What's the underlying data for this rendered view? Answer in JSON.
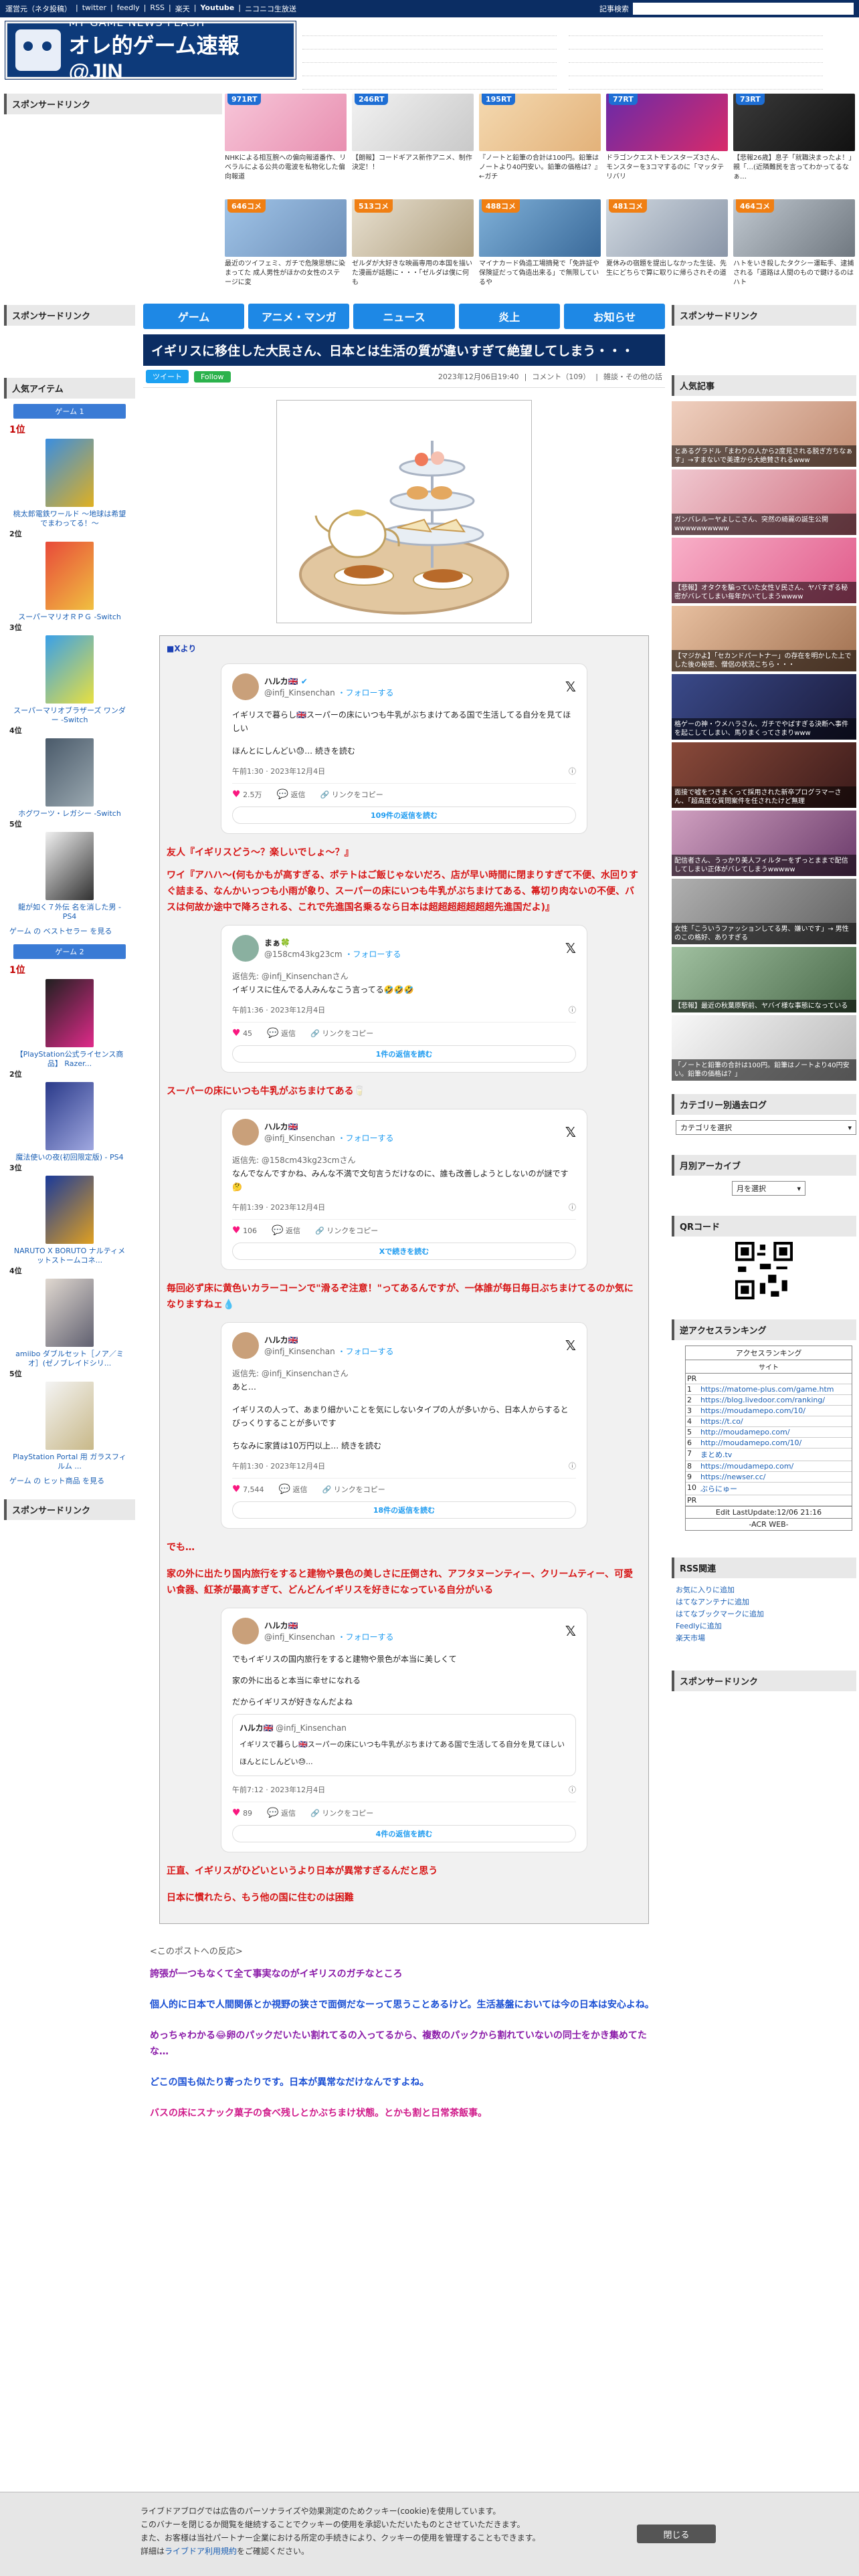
{
  "topbar": {
    "links": [
      "運営元（ネタ投稿）",
      "twitter",
      "feedly",
      "RSS",
      "楽天",
      "Youtube",
      "ニコニコ生放送"
    ],
    "search_label": "記事検索"
  },
  "logo": {
    "sub": "MY GAME NEWS FLASH",
    "main": "オレ的ゲーム速報@JIN"
  },
  "left": {
    "sponsor_title": "スポンサードリンク",
    "sponsor_title2": "スポンサードリンク",
    "popular_title": "人気アイテム",
    "game1_head": "ゲーム 1",
    "game1_ranks": [
      {
        "rank": "1位",
        "name": "桃太郎電鉄ワールド ～地球は希望でまわってる！～"
      },
      {
        "rank": "2位",
        "name": "スーパーマリオＲＰＧ -Switch"
      },
      {
        "rank": "3位",
        "name": "スーパーマリオブラザーズ ワンダー -Switch"
      },
      {
        "rank": "4位",
        "name": "ホグワーツ・レガシー -Switch"
      },
      {
        "rank": "5位",
        "name": "龍が如く７外伝 名を消した男 - PS4"
      }
    ],
    "game1_more": "ゲーム の ベストセラー を見る",
    "game2_head": "ゲーム 2",
    "game2_ranks": [
      {
        "rank": "1位",
        "name": "【PlayStation公式ライセンス商品】 Razer..."
      },
      {
        "rank": "2位",
        "name": "魔法使いの夜(初回限定版) - PS4"
      },
      {
        "rank": "3位",
        "name": "NARUTO X BORUTO ナルティメットストームコネ..."
      },
      {
        "rank": "4位",
        "name": "amiibo ダブルセット［ノア／ミオ］(ゼノブレイドシリ..."
      },
      {
        "rank": "5位",
        "name": "PlayStation Portal 用 ガラスフィルム ..."
      }
    ],
    "game2_more": "ゲーム の ヒット商品 を見る",
    "sponsor_title3": "スポンサードリンク"
  },
  "featured": [
    {
      "badge": "971RT",
      "caption": "NHKによる相互腕への偏向報道番作、リベラルによる公共の電波を私物化した偏向報道"
    },
    {
      "badge": "246RT",
      "caption": "【朗報】コードギアス新作アニメ、制作決定！！"
    },
    {
      "badge": "195RT",
      "caption": "『ノートと鉛筆の合計は100円。鉛筆はノートより40円安い。鉛筆の価格は？』←ガチ"
    },
    {
      "badge": "77RT",
      "caption": "ドラゴンクエストモンスターズ3さん、モンスターを3コマするのに「マッタテリバリ"
    },
    {
      "badge": "73RT",
      "caption": "【悲報26歳】息子「就職決まったよ！」親「…(近隣難民を言ってわかってるなぁ…"
    },
    {
      "badge": "646コメ",
      "caption": "最近のツイフェミ、ガチで危険思想に染まってた 成人男性がほかの女性のステージに変"
    },
    {
      "badge": "513コメ",
      "caption": "ゼルダが大好きな映画専用の本国を描いた漫画が話題に・・・「ゼルダは僕に何も"
    },
    {
      "badge": "488コメ",
      "caption": "マイナカード偽造工場摘発で「免許証や保険証だって偽造出来る」で無限しているや"
    },
    {
      "badge": "481コメ",
      "caption": "夏休みの宿題を提出しなかった生徒、先生にどちらで算に取りに帰らされその道"
    },
    {
      "badge": "464コメ",
      "caption": "ハトをいき殺したタクシー運転手、逮捕される「道路は人間のもので鍵けるのはハト"
    }
  ],
  "nav": [
    "ゲーム",
    "アニメ・マンガ",
    "ニュース",
    "炎上",
    "お知らせ"
  ],
  "article": {
    "title": "イギリスに移住した大民さん、日本とは生活の質が違いすぎて絶望してしまう・・・",
    "tweet_btn": "ツイート",
    "follow_btn": "Follow",
    "date": "2023年12月06日19:40",
    "comments": "コメント（109）",
    "category": "雑談・その他の話",
    "quote_src": "■Xより",
    "tweets": [
      {
        "name": "ハルカ🇬🇧",
        "handle": "@infj_Kinsenchan",
        "follow": "・フォローする",
        "reply_to": "",
        "lines": [
          "イギリスで暮らし🇬🇧スーパーの床にいつも牛乳がぶちまけてある国で生活してる自分を見てほしい",
          "ほんとにしんどい😓… 続きを読む"
        ],
        "time": "午前1:30 · 2023年12月4日",
        "likes": "2.5万",
        "replies": "返信",
        "share": "リンクをコピー",
        "more": "109件の返信を読む"
      },
      {
        "name": "まぁ🍀",
        "handle": "@158cm43kg23cm",
        "follow": "・フォローする",
        "reply_to": "返信先: @infj_Kinsenchanさん",
        "lines": [
          "イギリスに住んでる人みんなこう言ってる🤣🤣🤣"
        ],
        "time": "午前1:36 · 2023年12月4日",
        "likes": "45",
        "replies": "返信",
        "share": "リンクをコピー",
        "more": "1件の返信を読む"
      },
      {
        "name": "ハルカ🇬🇧",
        "handle": "@infj_Kinsenchan",
        "follow": "・フォローする",
        "reply_to": "返信先: @158cm43kg23cmさん",
        "lines": [
          "なんでなんですかね、みんな不満で文句言うだけなのに、誰も改善しようとしないのが謎です🤔"
        ],
        "time": "午前1:39 · 2023年12月4日",
        "likes": "106",
        "replies": "返信",
        "share": "リンクをコピー",
        "more": "Xで続きを読む"
      },
      {
        "name": "ハルカ🇬🇧",
        "handle": "@infj_Kinsenchan",
        "follow": "・フォローする",
        "reply_to": "返信先: @infj_Kinsenchanさん",
        "lines": [
          "あと…",
          "イギリスの人って、あまり細かいことを気にしないタイプの人が多いから、日本人からするとびっくりすることが多いです",
          "ちなみに家賃は10万円以上… 続きを読む"
        ],
        "time": "午前1:30 · 2023年12月4日",
        "likes": "7,544",
        "replies": "返信",
        "share": "リンクをコピー",
        "more": "18件の返信を読む"
      },
      {
        "name": "ハルカ🇬🇧",
        "handle": "@infj_Kinsenchan",
        "follow": "・フォローする",
        "reply_to": "",
        "lines": [
          "でもイギリスの国内旅行をすると建物や景色が本当に美しくて",
          "家の外に出ると本当に幸せになれる",
          "だからイギリスが好きなんだよね"
        ],
        "time": "午前7:12 · 2023年12月4日",
        "likes": "89",
        "replies": "返信",
        "share": "リンクをコピー",
        "more": "4件の返信を読む",
        "inner": {
          "name": "ハルカ🇬🇧",
          "handle": "@infj_Kinsenchan",
          "text": "イギリスで暮らし🇬🇧スーパーの床にいつも牛乳がぶちまけてある国で生活してる自分を見てほしい",
          "sub": "ほんとにしんどい😓..."
        }
      }
    ],
    "red_texts": [
      "友人『イギリスどう〜？楽しいでしょ〜？』",
      "ワイ『アハハ〜(何もかもが高すぎる、ポテトはご飯じゃないだろ、店が早い時間に閉まりすぎて不便、水回りすぐ詰まる、なんかいっつも小雨が象り、スーパーの床にいつも牛乳がぶちまけてある、箒切り肉ないの不便、バスは何故か途中で降ろされる、これで先進国名乗るなら日本は超超超超超超超先進国だよ)』",
      "スーパーの床にいつも牛乳がぶちまけてある🥛",
      "毎回必ず床に黄色いカラーコーンで\"滑るぞ注意！\"ってあるんですが、一体誰が毎日毎日ぶちまけてるのか気になりますねェ💧",
      "でも…",
      "家の外に出たり国内旅行をすると建物や景色の美しさに圧倒され、アフタヌーンティー、クリームティー、可愛い食器、紅茶が最高すぎて、どんどんイギリスを好きになっている自分がいる",
      "正直、イギリスがひどいというより日本が異常すぎるんだと思う",
      "日本に慣れたら、もう他の国に住むのは困難"
    ],
    "replies_head": "<このポストへの反応>",
    "replies": [
      "誇張が一つもなくて全て事実なのがイギリスのガチなところ",
      "個人的に日本で人間関係とか視野の狭さで面倒だなーって思うことあるけど。生活基盤においては今の日本は安心よね。",
      "めっちゃわかる😂卵のパックだいたい割れてるの入ってるから、複数のパックから割れていないの同士をかき集めてたな…",
      "どこの国も似たり寄ったりです。日本が異常なだけなんですよね。",
      "バスの床にスナック菓子の食べ残しとかぶちまけ状態。とかも割と日常茶飯事。"
    ]
  },
  "right": {
    "sponsor_title": "スポンサードリンク",
    "popular_title": "人気記事",
    "popular": [
      "とあるグラドル「まわりの人から2度見される脱ぎ方ちなぁす」→すまないで美達から大絶賛されるwww",
      "ガンバレルーヤよしこさん、突然の綺麗の誕生公開wwwwwwwwww",
      "【悲報】オタクを騙っていた女性Ｖ民さん、ヤバすぎる秘密がバレてしまい毎年かいてしまうwwww",
      "【マジかよ】「セカンドパートナー」の存在を明かした上でした後の秘密、僧侶の状況こちら・・・",
      "格ゲーの神・ウメハラさん、ガチでやばすぎる決断へ事件を起こしてしまい、馬りまくってさまりwww",
      "面接で嘘をつきまくって採用された新卒プログラマーさん、「超高度な質問案件を任されたけど無理",
      "配信者さん、うっかり美人フィルターをずっとままで配信してしまい正体がバレてしまうwwwww",
      "女性「こういうファッションしてる男、嫌いです」→ 男性のこの格好、ありすぎる",
      "【悲報】最近の秋葉原駅前、ヤバイ様な事態になっている",
      "「ノートと鉛筆の合計は100円。鉛筆はノートより40円安い。鉛筆の価格は？」"
    ],
    "category_title": "カテゴリー別過去ログ",
    "category_select": "カテゴリを選択",
    "monthly_title": "月別アーカイブ",
    "monthly_select": "月を選択",
    "qr_title": "QRコード",
    "access_title": "逆アクセスランキング",
    "access_head": "アクセスランキング",
    "access_sub": "サイト",
    "access_rows": [
      {
        "n": "PR",
        "site": ""
      },
      {
        "n": "1",
        "site": "https://matome-plus.com/game.htm"
      },
      {
        "n": "2",
        "site": "https://blog.livedoor.com/ranking/"
      },
      {
        "n": "3",
        "site": "https://moudamepo.com/10/"
      },
      {
        "n": "4",
        "site": "https://t.co/"
      },
      {
        "n": "5",
        "site": "http://moudamepo.com/"
      },
      {
        "n": "6",
        "site": "http://moudamepo.com/10/"
      },
      {
        "n": "7",
        "site": "まとめ.tv"
      },
      {
        "n": "8",
        "site": "https://moudamepo.com/"
      },
      {
        "n": "9",
        "site": "https://newser.cc/"
      },
      {
        "n": "10",
        "site": "ぶらにゅー"
      },
      {
        "n": "PR",
        "site": ""
      }
    ],
    "access_footer": "Edit LastUpdate:12/06 21:16",
    "access_footer2": "-ACR WEB-",
    "rss_title": "RSS関連",
    "rss_links": [
      "お気に入りに追加",
      "はてなアンテナに追加",
      "はてなブックマークに追加",
      "Feedlyに追加",
      "楽天市場"
    ],
    "sponsor_title2": "スポンサードリンク"
  },
  "cookie": {
    "lines": [
      "ライブドアブログでは広告のパーソナライズや効果測定のためクッキー(cookie)を使用しています。",
      "このバナーを閉じるか閲覧を継続することでクッキーの使用を承認いただいたものとさせていただきます。",
      "また、お客様は当社パートナー企業における所定の手続きにより、クッキーの使用を管理することもできます。"
    ],
    "link_pre": "詳細は",
    "link": "ライブドア利用規約",
    "link_post": "をご確認ください。",
    "close": "閉じる"
  }
}
